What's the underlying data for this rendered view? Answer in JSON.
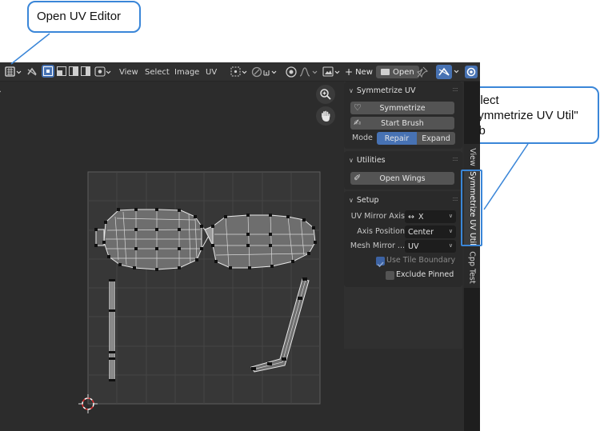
{
  "callouts": {
    "open_uv_editor": "Open UV Editor",
    "select_tab_line1": "Select",
    "select_tab_line2": "\"Symmetrize UV Util\"",
    "select_tab_line3": "tab"
  },
  "header": {
    "menus": [
      "View",
      "Select",
      "Image",
      "UV"
    ],
    "new_label": "New",
    "open_label": "Open",
    "accent_color": "#4772b3",
    "icons": [
      "editor-type-icon",
      "sync-icon",
      "vertex-select-icon",
      "edge-select-icon",
      "face-select-icon",
      "island-select-icon",
      "sticky-select-icon",
      "pivot-icon",
      "snap-icon",
      "proportional-icon",
      "falloff-icon",
      "image-browse-icon",
      "pin-icon",
      "gizmo-icon",
      "overlay-icon"
    ]
  },
  "viewport_tools": {
    "zoom_icon": "zoom-in-icon",
    "pan_icon": "hand-icon"
  },
  "panel": {
    "symmetrize_uv": {
      "title": "Symmetrize UV",
      "symmetrize_label": "Symmetrize",
      "start_brush_label": "Start Brush",
      "mode_label": "Mode",
      "mode_options": [
        "Repair",
        "Expand"
      ],
      "mode_selected": "Repair"
    },
    "utilities": {
      "title": "Utilities",
      "open_wings_label": "Open Wings"
    },
    "setup": {
      "title": "Setup",
      "uv_mirror_axis_label": "UV Mirror Axis",
      "uv_mirror_axis_value": "X",
      "axis_position_label": "Axis Position",
      "axis_position_value": "Center",
      "mesh_mirror_label": "Mesh Mirror ...",
      "mesh_mirror_value": "UV",
      "use_tile_boundary_label": "Use Tile Boundary",
      "use_tile_boundary_checked": true,
      "exclude_pinned_label": "Exclude Pinned",
      "exclude_pinned_checked": false
    }
  },
  "tabs": [
    "View",
    "Symmetrize UV Util",
    "Cpp Test"
  ],
  "active_tab": "Symmetrize UV Util"
}
